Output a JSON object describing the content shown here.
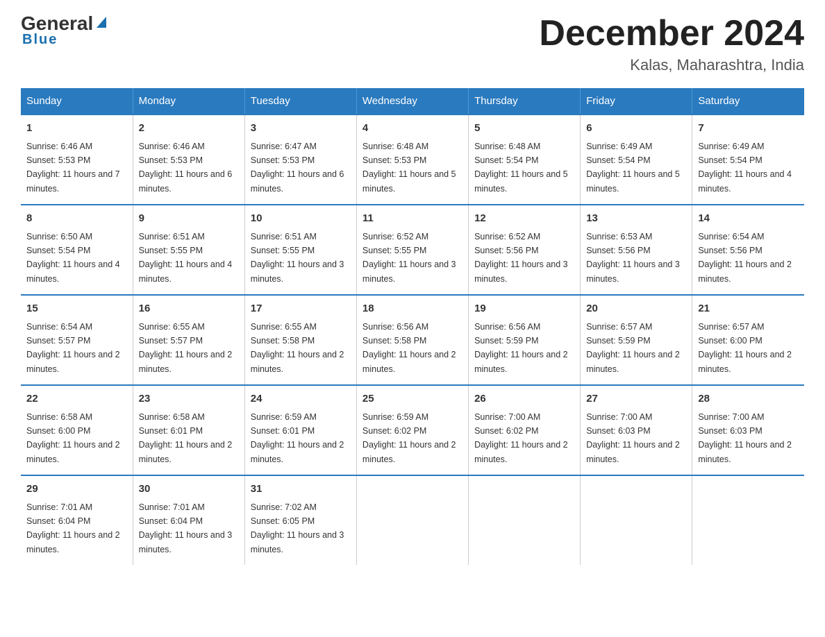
{
  "header": {
    "logo_general": "General",
    "logo_blue": "Blue",
    "month_title": "December 2024",
    "location": "Kalas, Maharashtra, India"
  },
  "days_of_week": [
    "Sunday",
    "Monday",
    "Tuesday",
    "Wednesday",
    "Thursday",
    "Friday",
    "Saturday"
  ],
  "weeks": [
    [
      {
        "day": "1",
        "sunrise": "6:46 AM",
        "sunset": "5:53 PM",
        "daylight": "11 hours and 7 minutes."
      },
      {
        "day": "2",
        "sunrise": "6:46 AM",
        "sunset": "5:53 PM",
        "daylight": "11 hours and 6 minutes."
      },
      {
        "day": "3",
        "sunrise": "6:47 AM",
        "sunset": "5:53 PM",
        "daylight": "11 hours and 6 minutes."
      },
      {
        "day": "4",
        "sunrise": "6:48 AM",
        "sunset": "5:53 PM",
        "daylight": "11 hours and 5 minutes."
      },
      {
        "day": "5",
        "sunrise": "6:48 AM",
        "sunset": "5:54 PM",
        "daylight": "11 hours and 5 minutes."
      },
      {
        "day": "6",
        "sunrise": "6:49 AM",
        "sunset": "5:54 PM",
        "daylight": "11 hours and 5 minutes."
      },
      {
        "day": "7",
        "sunrise": "6:49 AM",
        "sunset": "5:54 PM",
        "daylight": "11 hours and 4 minutes."
      }
    ],
    [
      {
        "day": "8",
        "sunrise": "6:50 AM",
        "sunset": "5:54 PM",
        "daylight": "11 hours and 4 minutes."
      },
      {
        "day": "9",
        "sunrise": "6:51 AM",
        "sunset": "5:55 PM",
        "daylight": "11 hours and 4 minutes."
      },
      {
        "day": "10",
        "sunrise": "6:51 AM",
        "sunset": "5:55 PM",
        "daylight": "11 hours and 3 minutes."
      },
      {
        "day": "11",
        "sunrise": "6:52 AM",
        "sunset": "5:55 PM",
        "daylight": "11 hours and 3 minutes."
      },
      {
        "day": "12",
        "sunrise": "6:52 AM",
        "sunset": "5:56 PM",
        "daylight": "11 hours and 3 minutes."
      },
      {
        "day": "13",
        "sunrise": "6:53 AM",
        "sunset": "5:56 PM",
        "daylight": "11 hours and 3 minutes."
      },
      {
        "day": "14",
        "sunrise": "6:54 AM",
        "sunset": "5:56 PM",
        "daylight": "11 hours and 2 minutes."
      }
    ],
    [
      {
        "day": "15",
        "sunrise": "6:54 AM",
        "sunset": "5:57 PM",
        "daylight": "11 hours and 2 minutes."
      },
      {
        "day": "16",
        "sunrise": "6:55 AM",
        "sunset": "5:57 PM",
        "daylight": "11 hours and 2 minutes."
      },
      {
        "day": "17",
        "sunrise": "6:55 AM",
        "sunset": "5:58 PM",
        "daylight": "11 hours and 2 minutes."
      },
      {
        "day": "18",
        "sunrise": "6:56 AM",
        "sunset": "5:58 PM",
        "daylight": "11 hours and 2 minutes."
      },
      {
        "day": "19",
        "sunrise": "6:56 AM",
        "sunset": "5:59 PM",
        "daylight": "11 hours and 2 minutes."
      },
      {
        "day": "20",
        "sunrise": "6:57 AM",
        "sunset": "5:59 PM",
        "daylight": "11 hours and 2 minutes."
      },
      {
        "day": "21",
        "sunrise": "6:57 AM",
        "sunset": "6:00 PM",
        "daylight": "11 hours and 2 minutes."
      }
    ],
    [
      {
        "day": "22",
        "sunrise": "6:58 AM",
        "sunset": "6:00 PM",
        "daylight": "11 hours and 2 minutes."
      },
      {
        "day": "23",
        "sunrise": "6:58 AM",
        "sunset": "6:01 PM",
        "daylight": "11 hours and 2 minutes."
      },
      {
        "day": "24",
        "sunrise": "6:59 AM",
        "sunset": "6:01 PM",
        "daylight": "11 hours and 2 minutes."
      },
      {
        "day": "25",
        "sunrise": "6:59 AM",
        "sunset": "6:02 PM",
        "daylight": "11 hours and 2 minutes."
      },
      {
        "day": "26",
        "sunrise": "7:00 AM",
        "sunset": "6:02 PM",
        "daylight": "11 hours and 2 minutes."
      },
      {
        "day": "27",
        "sunrise": "7:00 AM",
        "sunset": "6:03 PM",
        "daylight": "11 hours and 2 minutes."
      },
      {
        "day": "28",
        "sunrise": "7:00 AM",
        "sunset": "6:03 PM",
        "daylight": "11 hours and 2 minutes."
      }
    ],
    [
      {
        "day": "29",
        "sunrise": "7:01 AM",
        "sunset": "6:04 PM",
        "daylight": "11 hours and 2 minutes."
      },
      {
        "day": "30",
        "sunrise": "7:01 AM",
        "sunset": "6:04 PM",
        "daylight": "11 hours and 3 minutes."
      },
      {
        "day": "31",
        "sunrise": "7:02 AM",
        "sunset": "6:05 PM",
        "daylight": "11 hours and 3 minutes."
      },
      null,
      null,
      null,
      null
    ]
  ],
  "labels": {
    "sunrise_prefix": "Sunrise: ",
    "sunset_prefix": "Sunset: ",
    "daylight_prefix": "Daylight: "
  }
}
